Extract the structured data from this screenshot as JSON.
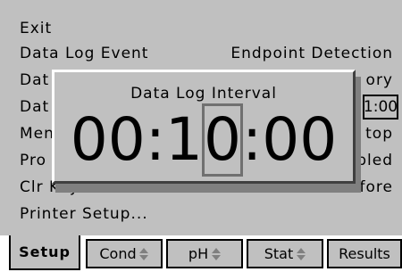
{
  "menu": {
    "exit": "Exit",
    "data_log_event": "Data Log Event",
    "endpoint_detection": "Endpoint Detection",
    "dat1": "Dat",
    "ory": "ory",
    "dat2": "Dat",
    "box_value": "1:00",
    "men": "Men",
    "top": "top",
    "pro": "Pro",
    "bled": "bled",
    "clr_key": "Clr Key",
    "deletes_results_before": "Deletes Results Before",
    "printer_setup": "Printer Setup..."
  },
  "dialog": {
    "title": "Data Log Interval",
    "time_digits": {
      "d1": "0",
      "d2": "0",
      "sep1": ":",
      "d3": "1",
      "d4": "0",
      "sep2": ":",
      "d5": "0",
      "d6": "0"
    }
  },
  "tabs": {
    "setup": "Setup",
    "cond": "Cond",
    "ph": "pH",
    "stat": "Stat",
    "results": "Results"
  },
  "colors": {
    "background": "#c0c0c0",
    "text": "#000000"
  },
  "icons": {
    "updown": "updown-arrows-icon"
  }
}
